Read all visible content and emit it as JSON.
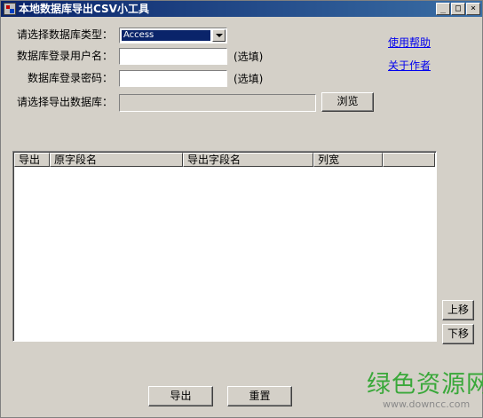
{
  "window": {
    "title": "本地数据库导出CSV小工具",
    "min_btn": "_",
    "max_btn": "□",
    "close_btn": "×"
  },
  "form": {
    "db_type_label": "请选择数据库类型：",
    "db_type_value": "Access",
    "username_label": "数据库登录用户名：",
    "username_value": "",
    "username_hint": "(选填)",
    "password_label": "数据库登录密码：",
    "password_value": "",
    "password_hint": "(选填)",
    "export_db_label": "请选择导出数据库：",
    "export_db_value": "",
    "browse_button": "浏览"
  },
  "links": {
    "help": "使用帮助",
    "about": "关于作者"
  },
  "table": {
    "columns": [
      "导出",
      "原字段名",
      "导出字段名",
      "列宽",
      ""
    ],
    "rows": []
  },
  "side_buttons": {
    "up": "上移",
    "down": "下移"
  },
  "bottom_buttons": {
    "export": "导出",
    "reset": "重置"
  },
  "watermark": {
    "brand": "绿色资源网",
    "url": "www.downcc.com"
  }
}
